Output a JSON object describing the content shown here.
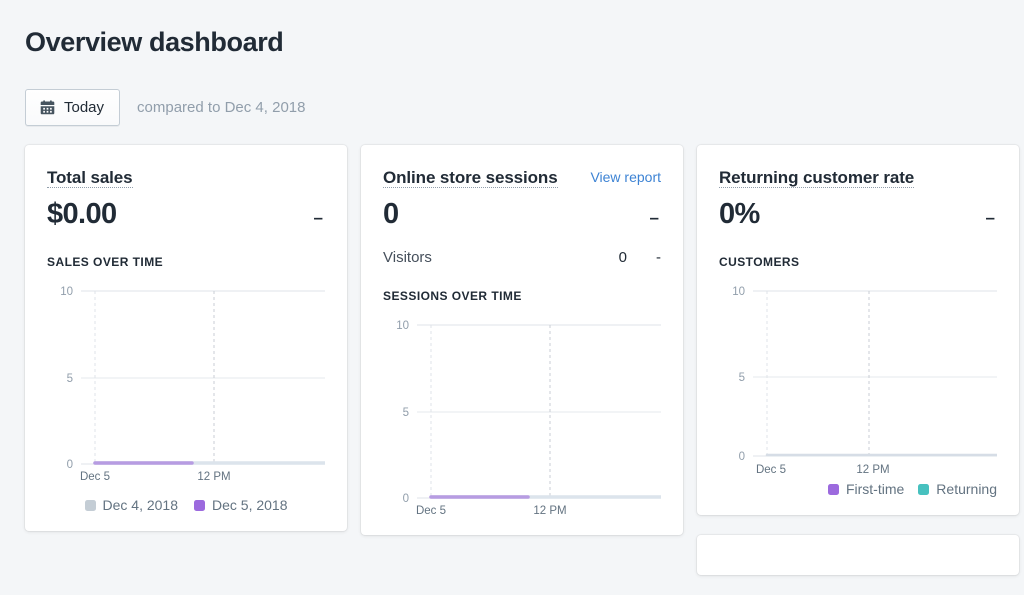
{
  "header": {
    "title": "Overview dashboard",
    "date_button": {
      "label": "Today",
      "icon": "calendar-icon"
    },
    "compared_to": "compared to Dec 4, 2018"
  },
  "colors": {
    "page_background": "#f4f6f8",
    "card_background": "#ffffff",
    "text_primary": "#212b36",
    "text_subdued": "#919eab",
    "link_blue": "#3d83d4",
    "series_purple": "#9c6ade",
    "series_grey": "#c4cdd5",
    "series_teal": "#47c1bf",
    "gridline": "#dfe3e8"
  },
  "cards": [
    {
      "id": "total-sales",
      "title": "Total sales",
      "value": "$0.00",
      "delta": "–",
      "section_label": "Sales over time",
      "legend": [
        {
          "label": "Dec 4, 2018",
          "color": "#c4cdd5"
        },
        {
          "label": "Dec 5, 2018",
          "color": "#9c6ade"
        }
      ]
    },
    {
      "id": "online-store-sessions",
      "title": "Online store sessions",
      "action_label": "View report",
      "value": "0",
      "delta": "–",
      "sub_metric": {
        "label": "Visitors",
        "value": "0",
        "delta": "-"
      },
      "section_label": "Sessions over time"
    },
    {
      "id": "returning-customer-rate",
      "title": "Returning customer rate",
      "value": "0%",
      "delta": "–",
      "section_label": "Customers",
      "legend": [
        {
          "label": "First-time",
          "color": "#9c6ade"
        },
        {
          "label": "Returning",
          "color": "#47c1bf"
        }
      ]
    }
  ],
  "chart_data": [
    {
      "id": "sales-over-time",
      "type": "line",
      "title": "Sales over time",
      "xlabel": "",
      "ylabel": "",
      "ylim": [
        0,
        10
      ],
      "yticks": [
        0,
        5,
        10
      ],
      "ytick_labels": [
        "0",
        "5",
        "10"
      ],
      "xticks": [
        "Dec 5",
        "12 PM"
      ],
      "grid": true,
      "legend_position": "bottom",
      "series": [
        {
          "name": "Dec 4, 2018",
          "color": "#c4cdd5",
          "values": [
            0,
            0,
            0,
            0,
            0,
            0,
            0,
            0,
            0,
            0,
            0,
            0
          ]
        },
        {
          "name": "Dec 5, 2018",
          "color": "#9c6ade",
          "values": [
            0,
            0,
            0,
            0,
            0
          ]
        }
      ]
    },
    {
      "id": "sessions-over-time",
      "type": "line",
      "title": "Sessions over time",
      "xlabel": "",
      "ylabel": "",
      "ylim": [
        0,
        10
      ],
      "yticks": [
        0,
        5,
        10
      ],
      "ytick_labels": [
        "0",
        "5",
        "10"
      ],
      "xticks": [
        "Dec 5",
        "12 PM"
      ],
      "grid": true,
      "legend_position": "none",
      "series": [
        {
          "name": "Dec 4, 2018",
          "color": "#c4cdd5",
          "values": [
            0,
            0,
            0,
            0,
            0,
            0,
            0,
            0,
            0,
            0,
            0,
            0
          ]
        },
        {
          "name": "Dec 5, 2018",
          "color": "#9c6ade",
          "values": [
            0,
            0,
            0,
            0,
            0
          ]
        }
      ]
    },
    {
      "id": "customers",
      "type": "line",
      "title": "Customers",
      "xlabel": "",
      "ylabel": "",
      "ylim": [
        0,
        10
      ],
      "yticks": [
        0,
        5,
        10
      ],
      "ytick_labels": [
        "0",
        "5",
        "10"
      ],
      "xticks": [
        "Dec 5",
        "12 PM"
      ],
      "grid": true,
      "legend_position": "bottom",
      "series": [
        {
          "name": "First-time",
          "color": "#9c6ade",
          "values": [
            0,
            0,
            0,
            0,
            0,
            0,
            0,
            0,
            0,
            0,
            0,
            0
          ]
        },
        {
          "name": "Returning",
          "color": "#47c1bf",
          "values": [
            0,
            0,
            0,
            0,
            0,
            0,
            0,
            0,
            0,
            0,
            0,
            0
          ]
        }
      ]
    }
  ]
}
